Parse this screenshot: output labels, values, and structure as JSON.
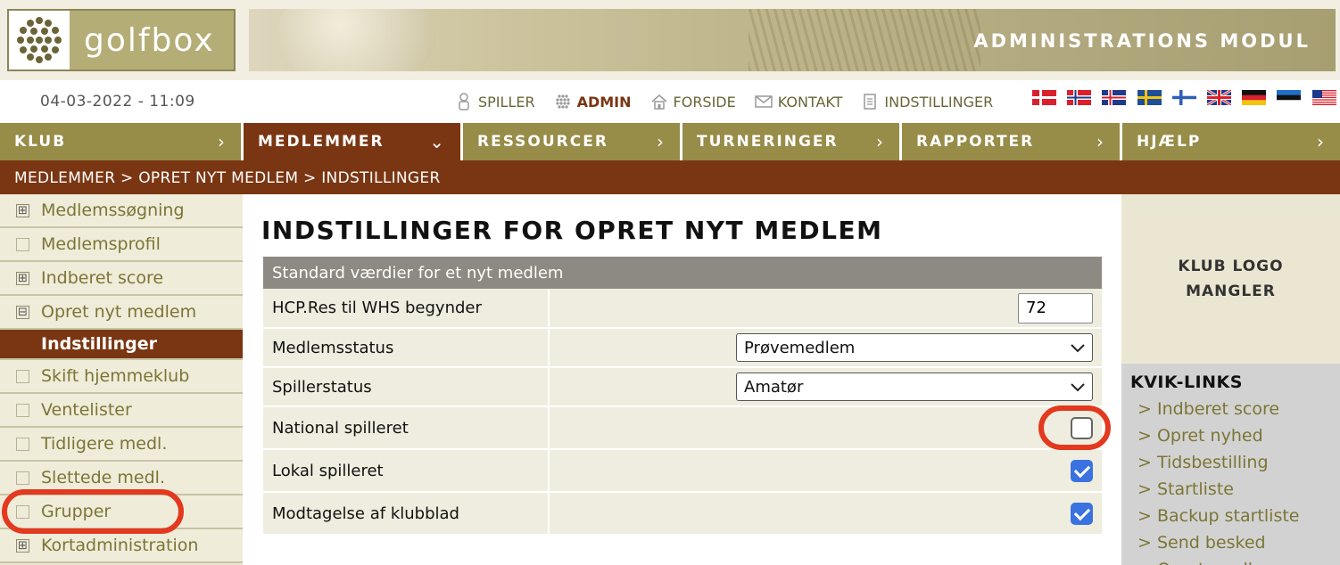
{
  "header": {
    "logo_text": "golfbox",
    "module_title": "ADMINISTRATIONS MODUL",
    "datetime": "04-03-2022 - 11:09"
  },
  "top_links": [
    {
      "label": "SPILLER",
      "icon": "person-icon",
      "active": false
    },
    {
      "label": "ADMIN",
      "icon": "admin-grid-icon",
      "active": true
    },
    {
      "label": "FORSIDE",
      "icon": "home-icon",
      "active": false
    },
    {
      "label": "KONTAKT",
      "icon": "mail-icon",
      "active": false
    },
    {
      "label": "INDSTILLINGER",
      "icon": "document-icon",
      "active": false
    }
  ],
  "flags": [
    "denmark-flag-icon",
    "norway-flag-icon",
    "iceland-flag-icon",
    "sweden-flag-icon",
    "finland-flag-icon",
    "uk-flag-icon",
    "germany-flag-icon",
    "estonia-flag-icon",
    "usa-flag-icon"
  ],
  "nav": [
    {
      "label": "KLUB",
      "arrow": "›",
      "active": false
    },
    {
      "label": "MEDLEMMER",
      "arrow": "⌄",
      "active": true
    },
    {
      "label": "RESSOURCER",
      "arrow": "›",
      "active": false
    },
    {
      "label": "TURNERINGER",
      "arrow": "›",
      "active": false
    },
    {
      "label": "RAPPORTER",
      "arrow": "›",
      "active": false
    },
    {
      "label": "HJÆLP",
      "arrow": "›",
      "active": false
    }
  ],
  "breadcrumb": "MEDLEMMER > OPRET NYT MEDLEM > INDSTILLINGER",
  "sidebar": {
    "items": [
      {
        "label": "Medlemssøgning",
        "box": "⊞"
      },
      {
        "label": "Medlemsprofil",
        "box": ""
      },
      {
        "label": "Indberet score",
        "box": "⊞"
      },
      {
        "label": "Opret nyt medlem",
        "box": "⊟"
      },
      {
        "label": "Indstillinger",
        "box": null
      },
      {
        "label": "Skift hjemmeklub",
        "box": ""
      },
      {
        "label": "Ventelister",
        "box": ""
      },
      {
        "label": "Tidligere medl.",
        "box": ""
      },
      {
        "label": "Slettede medl.",
        "box": ""
      },
      {
        "label": "Grupper",
        "box": ""
      },
      {
        "label": "Kortadministration",
        "box": "⊞"
      }
    ]
  },
  "main": {
    "title": "INDSTILLINGER FOR OPRET NYT MEDLEM",
    "table_header": "Standard værdier for et nyt medlem",
    "rows": {
      "hcp_label": "HCP.Res til WHS begynder",
      "hcp_value": "72",
      "status_label": "Medlemsstatus",
      "status_value": "Prøvemedlem",
      "player_status_label": "Spillerstatus",
      "player_status_value": "Amatør",
      "national_label": "National spilleret",
      "national_checked": false,
      "local_label": "Lokal spilleret",
      "local_checked": true,
      "magazine_label": "Modtagelse af klubblad",
      "magazine_checked": true
    }
  },
  "right_panel": {
    "logo_missing_line1": "KLUB LOGO",
    "logo_missing_line2": "MANGLER",
    "quick_links_title": "KVIK-LINKS",
    "quick_links": [
      "> Indberet score",
      "> Opret nyhed",
      "> Tidsbestilling",
      "> Startliste",
      "> Backup startliste",
      "> Send besked",
      "> Opret medlem"
    ]
  },
  "colors": {
    "brand_olive": "#978c48",
    "brand_brown": "#7a3612",
    "highlight_red": "#e2391f",
    "checkbox_blue": "#3a73e0"
  }
}
